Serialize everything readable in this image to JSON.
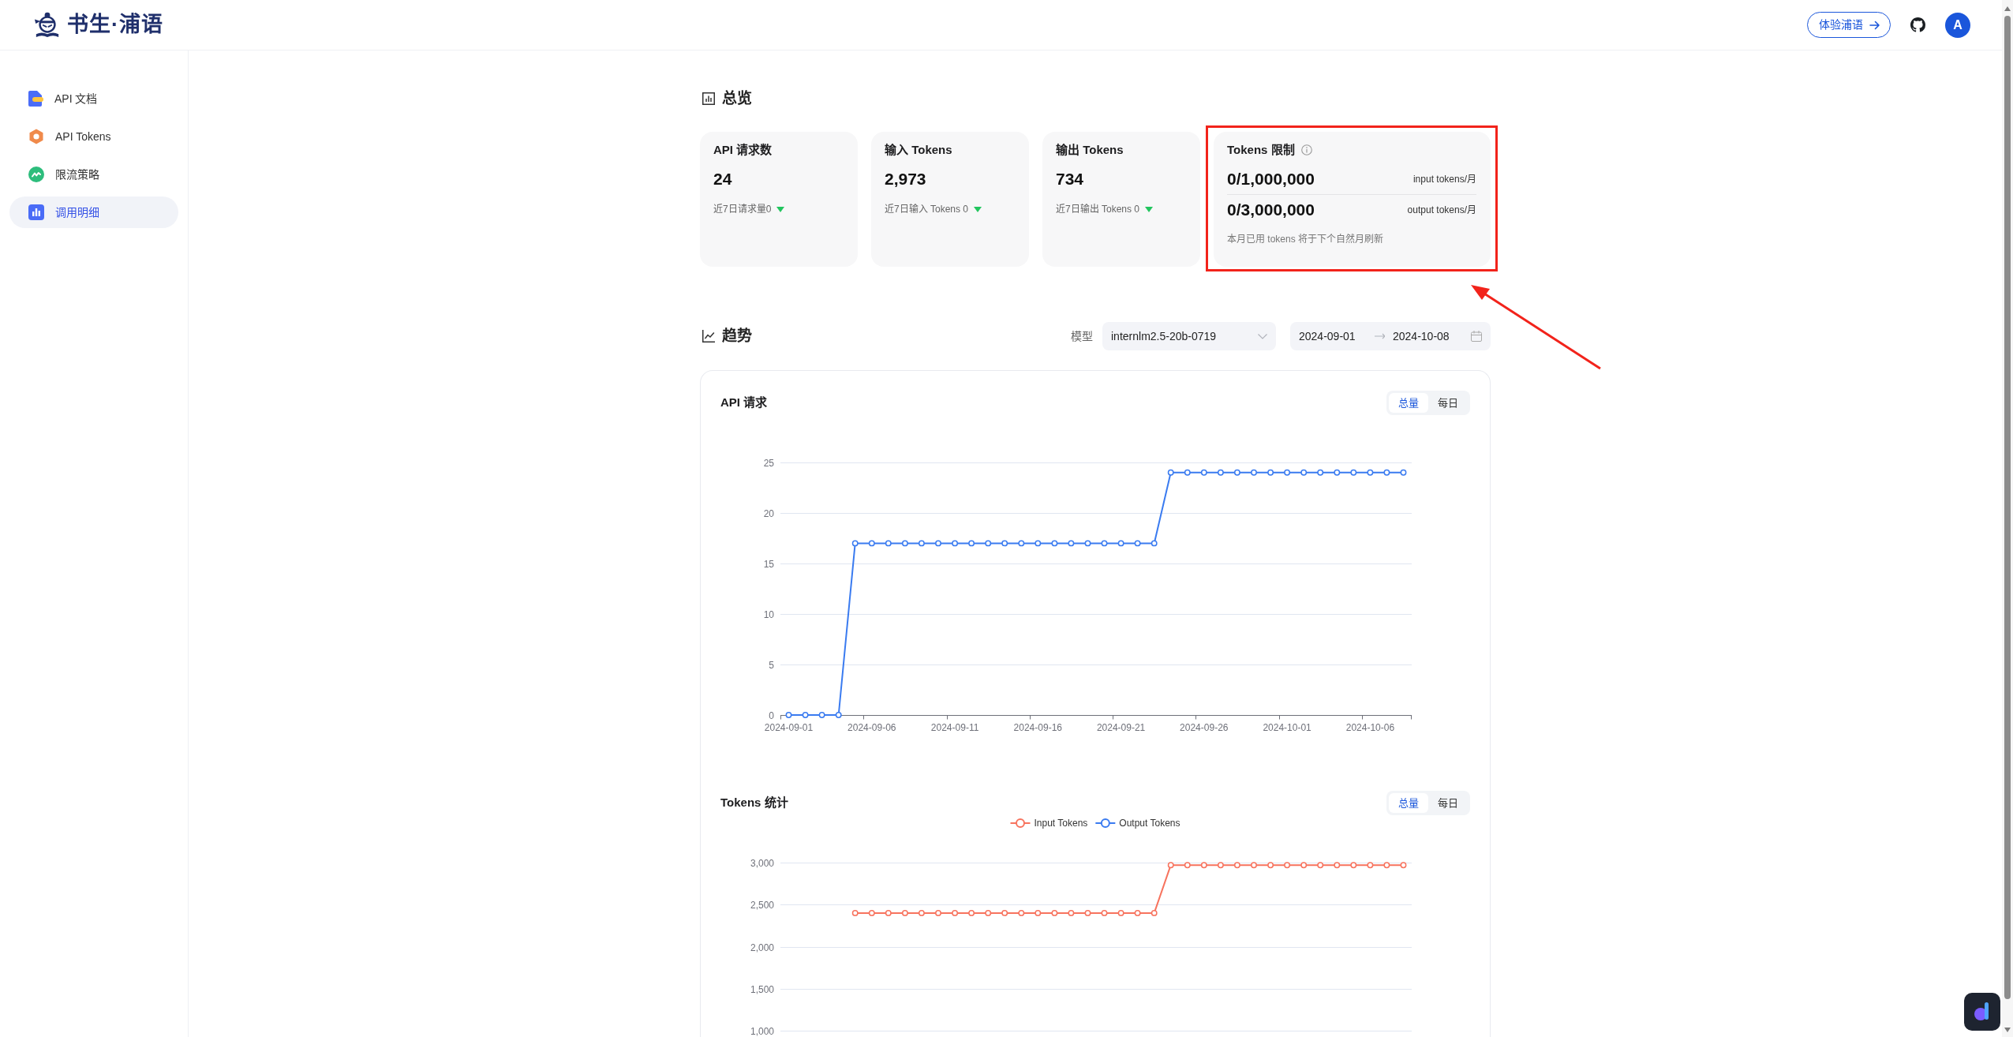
{
  "header": {
    "brand": "书生·浦语",
    "try_button": "体验浦语",
    "avatar": "A"
  },
  "sidebar": {
    "items": [
      {
        "kind": "docs",
        "label": "API 文档",
        "selected": false
      },
      {
        "kind": "tokens",
        "label": "API Tokens",
        "selected": false
      },
      {
        "kind": "limits",
        "label": "限流策略",
        "selected": false
      },
      {
        "kind": "usage",
        "label": "调用明细",
        "selected": true
      }
    ]
  },
  "overview": {
    "title": "总览",
    "cards": [
      {
        "kind": "stat",
        "title": "API 请求数",
        "value": "24",
        "note": "近7日请求量0",
        "highlighted": false
      },
      {
        "kind": "stat",
        "title": "输入 Tokens",
        "value": "2,973",
        "note": "近7日输入 Tokens 0",
        "highlighted": false
      },
      {
        "kind": "stat",
        "title": "输出 Tokens",
        "value": "734",
        "note": "近7日输出 Tokens 0",
        "highlighted": false
      },
      {
        "kind": "limit",
        "title": "Tokens 限制",
        "rows": [
          {
            "value": "0/1,000,000",
            "unit": "input tokens/月"
          },
          {
            "value": "0/3,000,000",
            "unit": "output tokens/月"
          }
        ],
        "note": "本月已用 tokens 将于下个自然月刷新",
        "highlighted": true
      }
    ]
  },
  "trend": {
    "title": "趋势",
    "model_label": "模型",
    "model": "internlm2.5-20b-0719",
    "date_start": "2024-09-01",
    "date_end": "2024-10-08",
    "charts": [
      {
        "title": "API 请求",
        "toggle": [
          {
            "label": "总量",
            "selected": true
          },
          {
            "label": "每日",
            "selected": false
          }
        ],
        "chart_data": {
          "type": "line",
          "grid": true,
          "categories": [
            "2024-09-01",
            null,
            null,
            null,
            null,
            "2024-09-06",
            null,
            null,
            null,
            null,
            "2024-09-11",
            null,
            null,
            null,
            null,
            "2024-09-16",
            null,
            null,
            null,
            null,
            "2024-09-21",
            null,
            null,
            null,
            null,
            "2024-09-26",
            null,
            null,
            null,
            null,
            "2024-10-01",
            null,
            null,
            null,
            null,
            "2024-10-06",
            null,
            null
          ],
          "ylim": [
            0,
            25
          ],
          "yticks": [
            0,
            5,
            10,
            15,
            20,
            25
          ],
          "series": [
            {
              "color": "#3a7bf0",
              "marker": "circle",
              "values": [
                0,
                0,
                0,
                0,
                17,
                17,
                17,
                17,
                17,
                17,
                17,
                17,
                17,
                17,
                17,
                17,
                17,
                17,
                17,
                17,
                17,
                17,
                17,
                24,
                24,
                24,
                24,
                24,
                24,
                24,
                24,
                24,
                24,
                24,
                24,
                24,
                24,
                24
              ]
            }
          ]
        }
      },
      {
        "title": "Tokens 统计",
        "toggle": [
          {
            "label": "总量",
            "selected": true
          },
          {
            "label": "每日",
            "selected": false
          }
        ],
        "chart_data": {
          "type": "line",
          "grid": true,
          "ylim": [
            1000,
            3000
          ],
          "yticks": [
            {
              "value": 1000,
              "label": "1,000"
            },
            {
              "value": 1500,
              "label": "1,500"
            },
            {
              "value": 2000,
              "label": "2,000"
            },
            {
              "value": 2500,
              "label": "2,500"
            },
            {
              "value": 3000,
              "label": "3,000"
            }
          ],
          "series": [
            {
              "name": "Input Tokens",
              "color": "#f7735e",
              "marker": "circle",
              "values": [
                null,
                null,
                null,
                null,
                2400,
                2400,
                2400,
                2400,
                2400,
                2400,
                2400,
                2400,
                2400,
                2400,
                2400,
                2400,
                2400,
                2400,
                2400,
                2400,
                2400,
                2400,
                2400,
                2970,
                2970,
                2970,
                2970,
                2970,
                2970,
                2970,
                2970,
                2970,
                2970,
                2970,
                2970,
                2970,
                2970,
                2970
              ]
            },
            {
              "name": "Output Tokens",
              "color": "#3a7bf0",
              "marker": "circle"
            }
          ]
        }
      }
    ]
  }
}
